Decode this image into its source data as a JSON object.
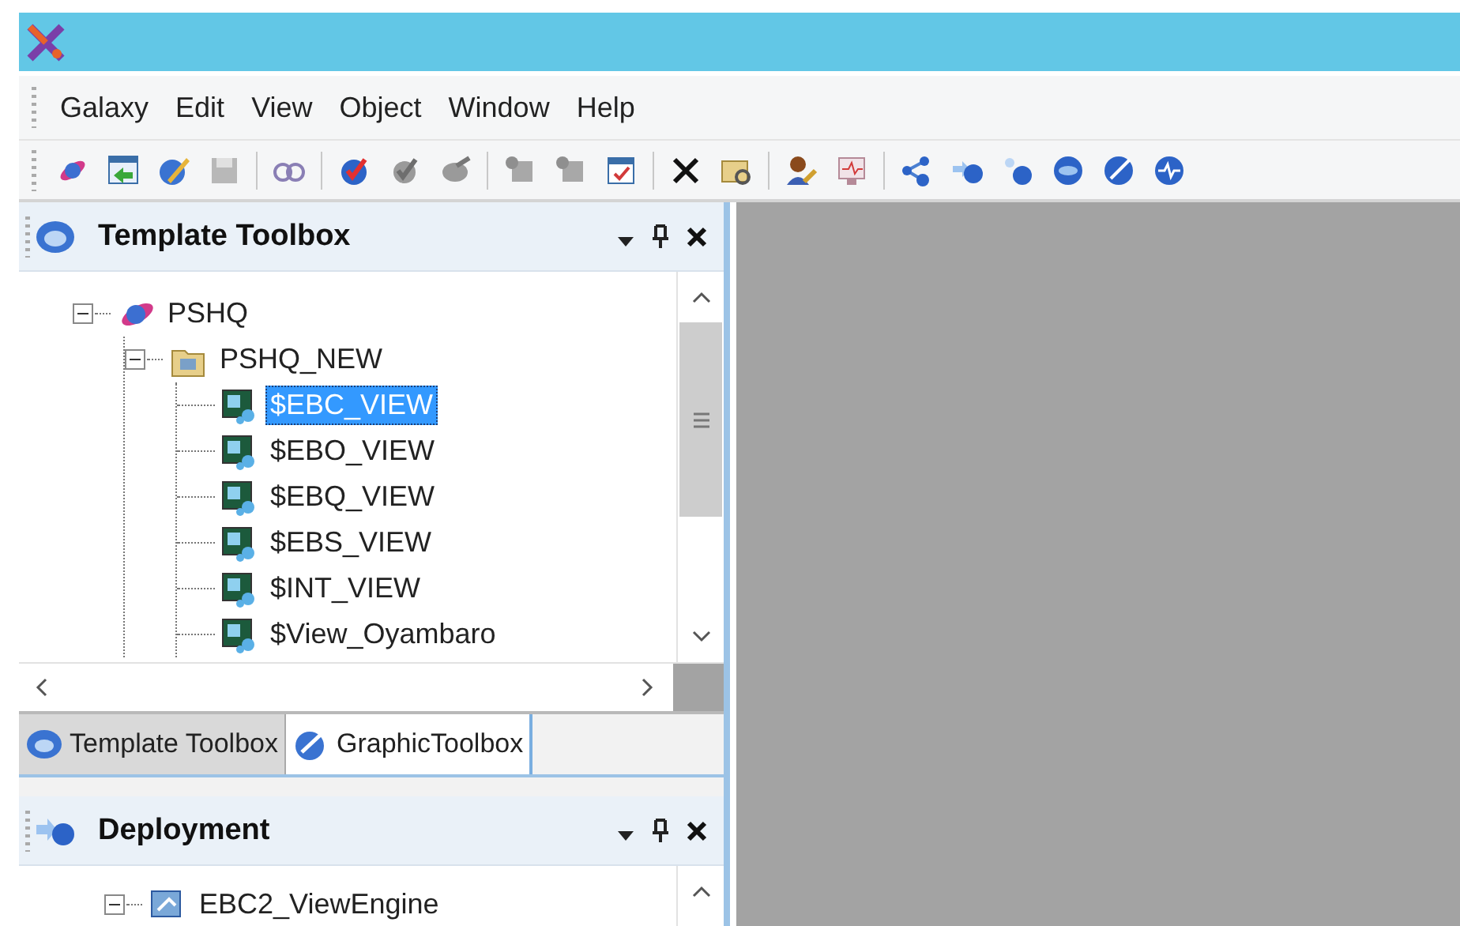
{
  "menu": [
    "Galaxy",
    "Edit",
    "View",
    "Object",
    "Window",
    "Help"
  ],
  "template_toolbox": {
    "title": "Template Toolbox",
    "tree": [
      {
        "label": "PSHQ",
        "kind": "galaxy",
        "expanded": true,
        "selected": false,
        "children": [
          {
            "label": "PSHQ_NEW",
            "kind": "folder",
            "expanded": true,
            "selected": false,
            "children": [
              {
                "label": "$EBC_VIEW",
                "kind": "template",
                "selected": true
              },
              {
                "label": "$EBO_VIEW",
                "kind": "template",
                "selected": false
              },
              {
                "label": "$EBQ_VIEW",
                "kind": "template",
                "selected": false
              },
              {
                "label": "$EBS_VIEW",
                "kind": "template",
                "selected": false
              },
              {
                "label": "$INT_VIEW",
                "kind": "template",
                "selected": false
              },
              {
                "label": "$View_Oyambaro",
                "kind": "template",
                "selected": false
              }
            ]
          }
        ]
      }
    ]
  },
  "toolbox_tabs": [
    {
      "label": "Template Toolbox",
      "kind": "template",
      "selected": false
    },
    {
      "label": "GraphicToolbox",
      "kind": "graphic",
      "selected": true
    }
  ],
  "deployment": {
    "title": "Deployment",
    "tree": [
      {
        "label": "EBC2_ViewEngine",
        "kind": "engine",
        "expanded": true,
        "selected": false
      }
    ]
  }
}
